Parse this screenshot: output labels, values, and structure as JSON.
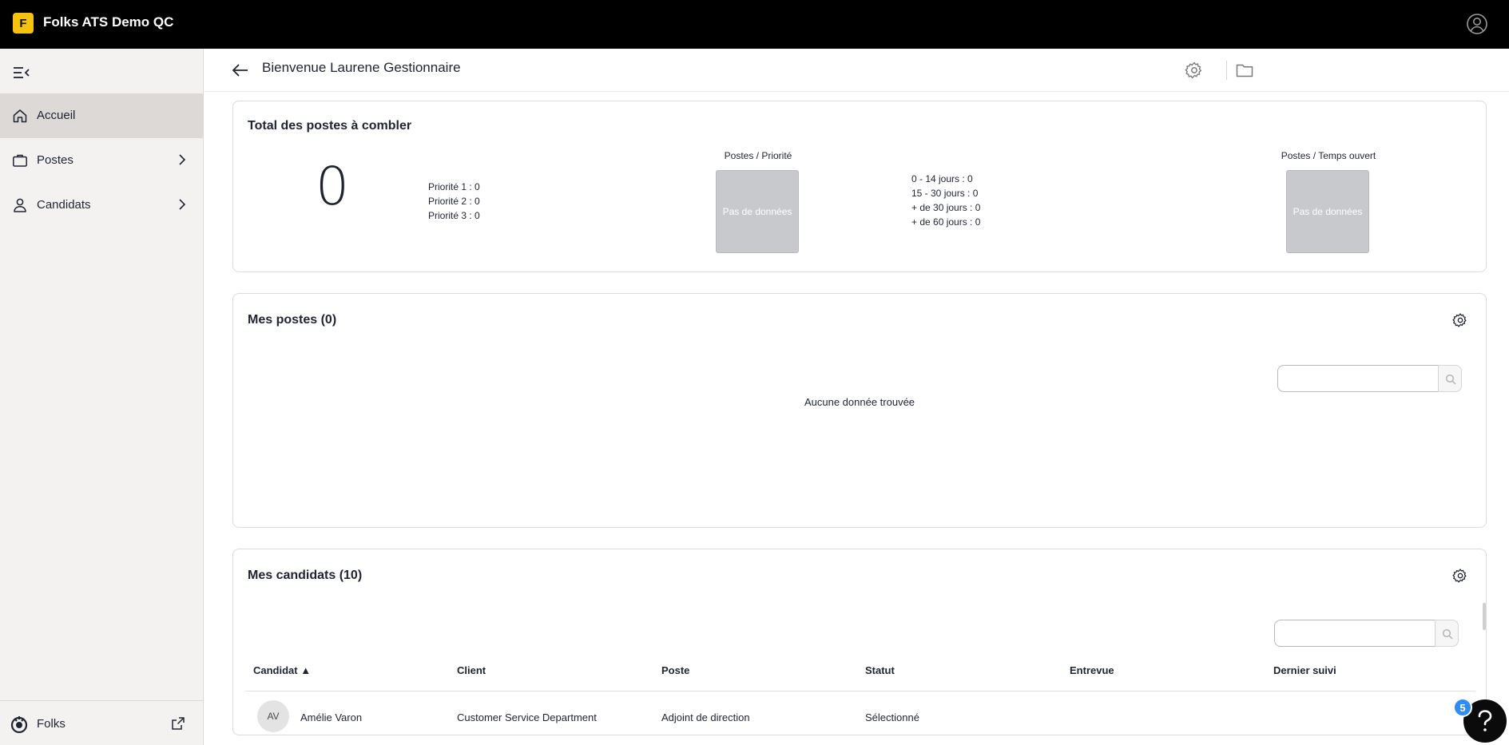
{
  "app": {
    "logo_letter": "F",
    "title": "Folks ATS Demo QC",
    "brand_color": "#f5c20f"
  },
  "sidebar": {
    "items": [
      {
        "label": "Accueil",
        "icon": "home-icon",
        "active": true
      },
      {
        "label": "Postes",
        "icon": "briefcase-icon",
        "active": false
      },
      {
        "label": "Candidats",
        "icon": "person-icon",
        "active": false
      }
    ],
    "footer_label": "Folks"
  },
  "header": {
    "title": "Bienvenue Laurene Gestionnaire"
  },
  "summary": {
    "title": "Total des postes à combler",
    "total": "0",
    "priorities": [
      "Priorité 1 : 0",
      "Priorité 2 : 0",
      "Priorité 3 : 0"
    ],
    "priority_chart_caption": "Postes / Priorité",
    "no_data": "Pas de données",
    "time_ranges": [
      "0 - 14 jours : 0",
      "15 - 30 jours : 0",
      "+ de 30 jours : 0",
      "+ de 60 jours : 0"
    ],
    "time_chart_caption": "Postes / Temps ouvert"
  },
  "my_posts": {
    "title": "Mes postes (0)",
    "empty_message": "Aucune donnée trouvée",
    "search_placeholder": ""
  },
  "my_candidates": {
    "title": "Mes candidats (10)",
    "search_placeholder": "",
    "columns": [
      "Candidat ▲",
      "Client",
      "Poste",
      "Statut",
      "Entrevue",
      "Dernier suivi"
    ],
    "rows": [
      {
        "initials": "AV",
        "name": "Amélie Varon",
        "client": "Customer Service Department",
        "poste": "Adjoint de direction",
        "statut": "Sélectionné",
        "entrevue": "",
        "dernier_suivi": ""
      }
    ]
  },
  "help": {
    "badge": "5"
  }
}
